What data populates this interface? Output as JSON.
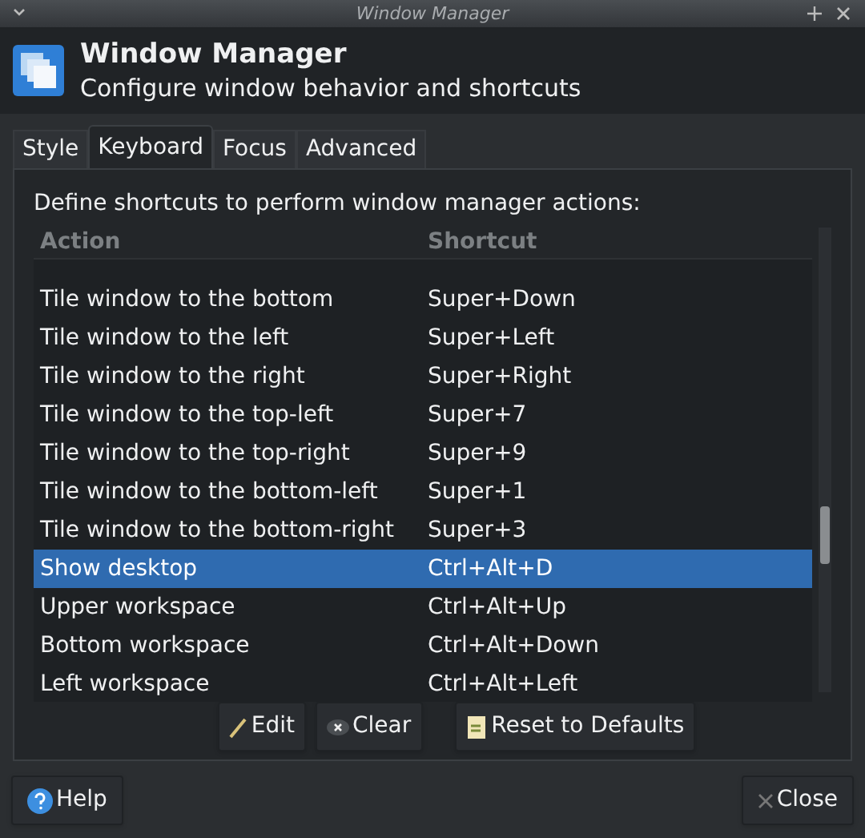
{
  "window": {
    "title": "Window Manager"
  },
  "header": {
    "title": "Window Manager",
    "subtitle": "Configure window behavior and shortcuts"
  },
  "tabs": [
    {
      "label": "Style",
      "selected": false
    },
    {
      "label": "Keyboard",
      "selected": true
    },
    {
      "label": "Focus",
      "selected": false
    },
    {
      "label": "Advanced",
      "selected": false
    }
  ],
  "description": "Define shortcuts to perform window manager actions:",
  "table": {
    "columns": [
      "Action",
      "Shortcut"
    ],
    "rows": [
      {
        "action": "Tile window to the bottom",
        "shortcut": "Super+Down",
        "selected": false
      },
      {
        "action": "Tile window to the left",
        "shortcut": "Super+Left",
        "selected": false
      },
      {
        "action": "Tile window to the right",
        "shortcut": "Super+Right",
        "selected": false
      },
      {
        "action": "Tile window to the top-left",
        "shortcut": "Super+7",
        "selected": false
      },
      {
        "action": "Tile window to the top-right",
        "shortcut": "Super+9",
        "selected": false
      },
      {
        "action": "Tile window to the bottom-left",
        "shortcut": "Super+1",
        "selected": false
      },
      {
        "action": "Tile window to the bottom-right",
        "shortcut": "Super+3",
        "selected": false
      },
      {
        "action": "Show desktop",
        "shortcut": "Ctrl+Alt+D",
        "selected": true
      },
      {
        "action": "Upper workspace",
        "shortcut": "Ctrl+Alt+Up",
        "selected": false
      },
      {
        "action": "Bottom workspace",
        "shortcut": "Ctrl+Alt+Down",
        "selected": false
      },
      {
        "action": "Left workspace",
        "shortcut": "Ctrl+Alt+Left",
        "selected": false
      }
    ]
  },
  "actions": [
    {
      "kind": "edit",
      "label": "Edit"
    },
    {
      "kind": "clear",
      "label": "Clear"
    },
    {
      "kind": "reset",
      "label": "Reset to Defaults"
    }
  ],
  "footer": [
    {
      "kind": "help",
      "label": "Help"
    },
    {
      "kind": "close",
      "label": "Close"
    }
  ]
}
